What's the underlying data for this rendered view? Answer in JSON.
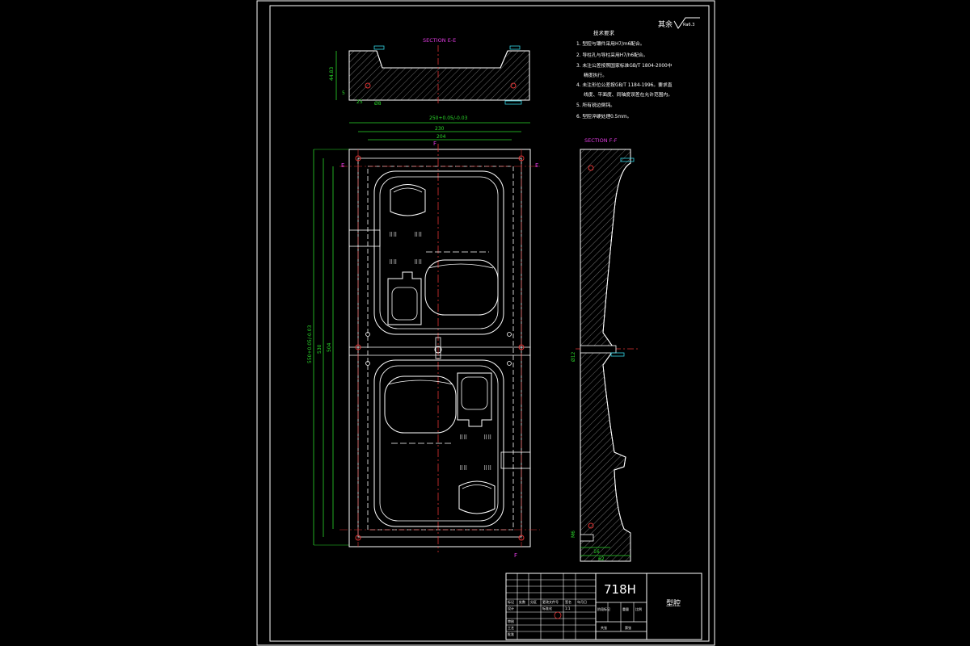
{
  "colors": {
    "background": "#000000",
    "outline": "#ffffff",
    "dimension": "#2bd92b",
    "section_label": "#e03be0",
    "center_line": "#e03333",
    "datum": "#33d6e8",
    "hatch": "#8a8a8a"
  },
  "roughness": {
    "label": "其余",
    "value": "Ra6.3"
  },
  "notes": {
    "heading": "技术要求",
    "items": [
      "1. 型腔与镶件采用H7/m6配合。",
      "2. 导柱孔与导柱采用H7/h6配合。",
      "3. 未注公差按照国家标准GB/T 1804-2000中",
      "精度执行。",
      "4. 未注形位公差按GB/T 1184-1996。要求直",
      "线度、平面度、同轴度误差在允许范围内。",
      "5. 所有锐边倒钝。",
      "6. 型腔淬硬处理0.5mm。"
    ]
  },
  "section_ee": {
    "title": "SECTION E-E",
    "dims": [
      "44.83",
      "5",
      "25",
      "Ø8"
    ]
  },
  "section_ff": {
    "title": "SECTION F-F",
    "dims": [
      "Ø12",
      "M6",
      "16",
      "62"
    ]
  },
  "plan_view": {
    "dims_top": [
      "250+0.05/-0.03",
      "230",
      "204"
    ],
    "dims_left": [
      "550+0.05/-0.03",
      "530",
      "504"
    ],
    "markers": [
      "E",
      "E",
      "F",
      "F"
    ]
  },
  "title_block": {
    "material": "718H",
    "part_name": "型腔",
    "header_cells": [
      "标记",
      "处数",
      "分区",
      "更改文件号",
      "签名",
      "年月日"
    ],
    "sign_labels": [
      "设计",
      "审核",
      "工艺",
      "批准"
    ],
    "stage_labels": [
      "阶段标记",
      "重量",
      "比例"
    ],
    "sheet_labels": [
      "共张",
      "第张"
    ],
    "scale_cells": [
      "标准化",
      "1:1"
    ]
  }
}
